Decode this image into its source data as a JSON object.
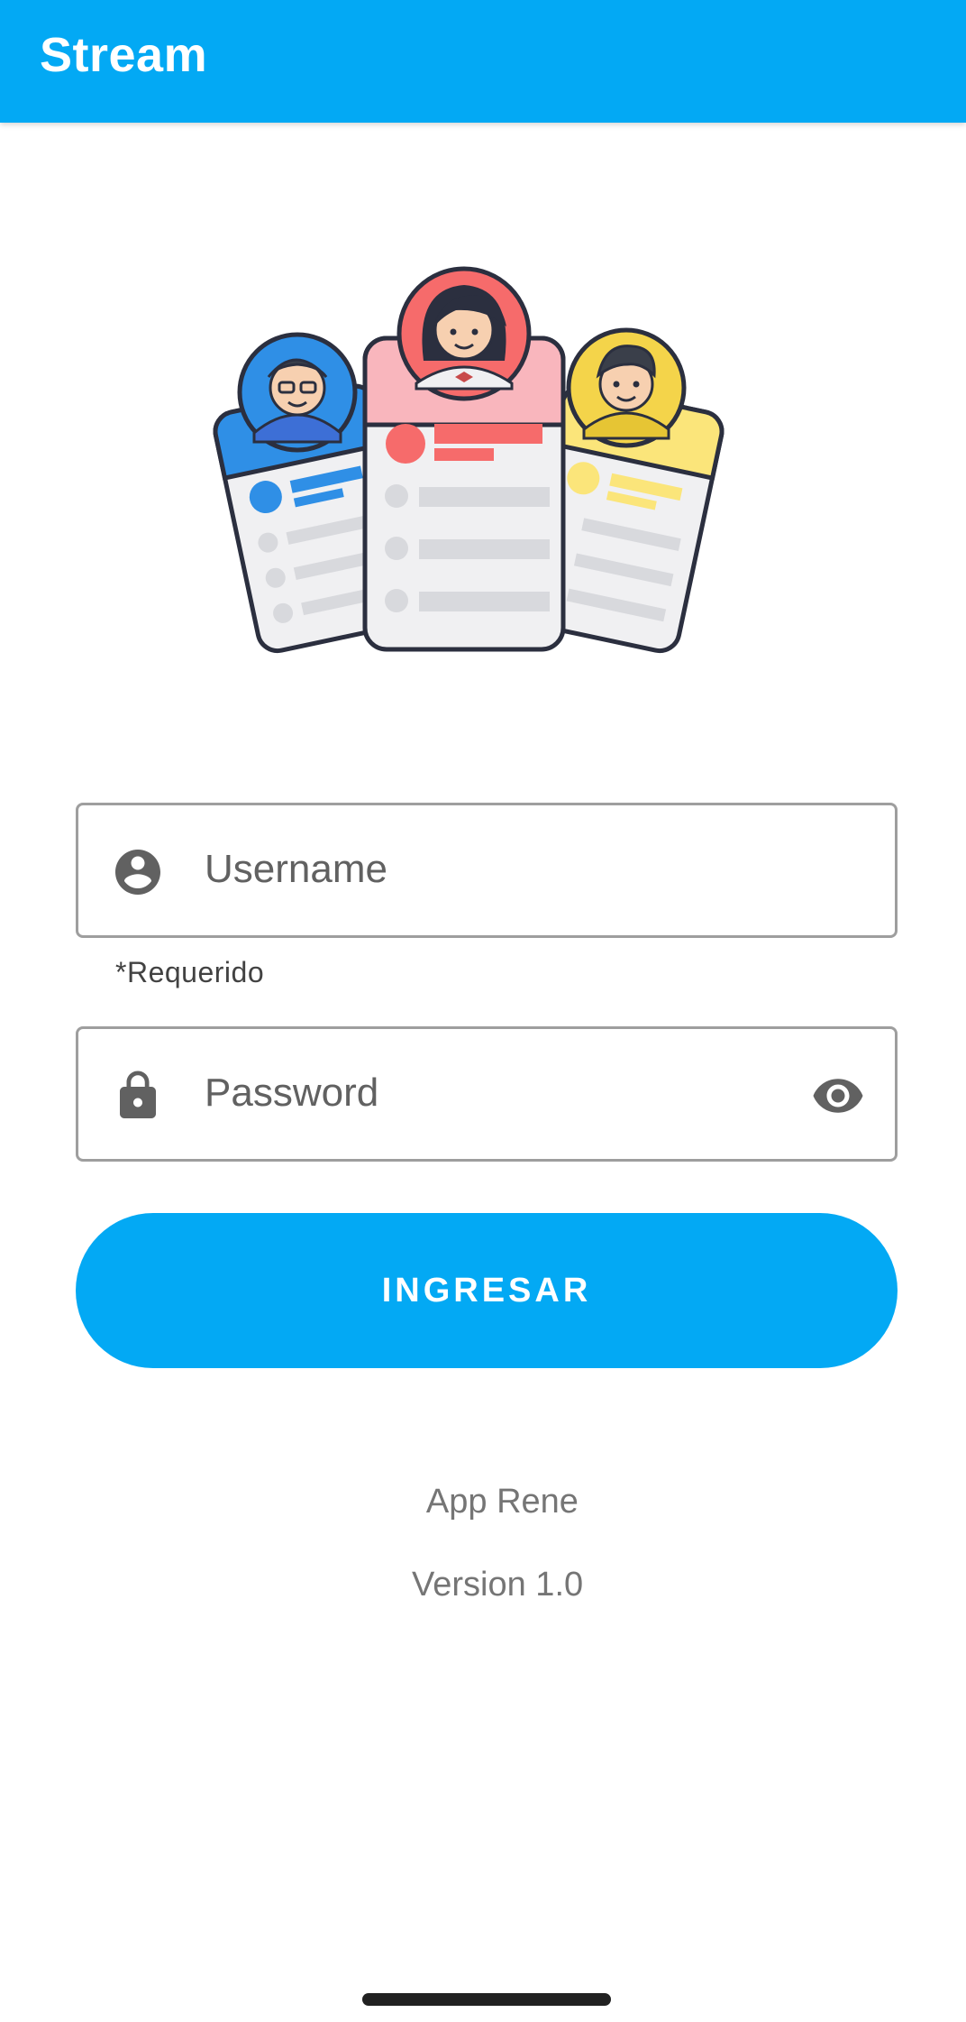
{
  "app_bar": {
    "title": "Stream"
  },
  "illustration": {
    "icon": "user-profile-cards-illustration"
  },
  "username_field": {
    "placeholder": "Username",
    "icon": "account-circle-icon",
    "helper": "*Requerido"
  },
  "password_field": {
    "placeholder": "Password",
    "icon": "lock-icon",
    "toggle_icon": "eye-icon"
  },
  "login_button": {
    "label": "INGRESAR"
  },
  "footer": {
    "app_name": "App Rene",
    "version": "Version 1.0"
  },
  "colors": {
    "primary": "#03A9F4",
    "field_border": "#9e9e9e",
    "icon_gray": "#616161"
  }
}
